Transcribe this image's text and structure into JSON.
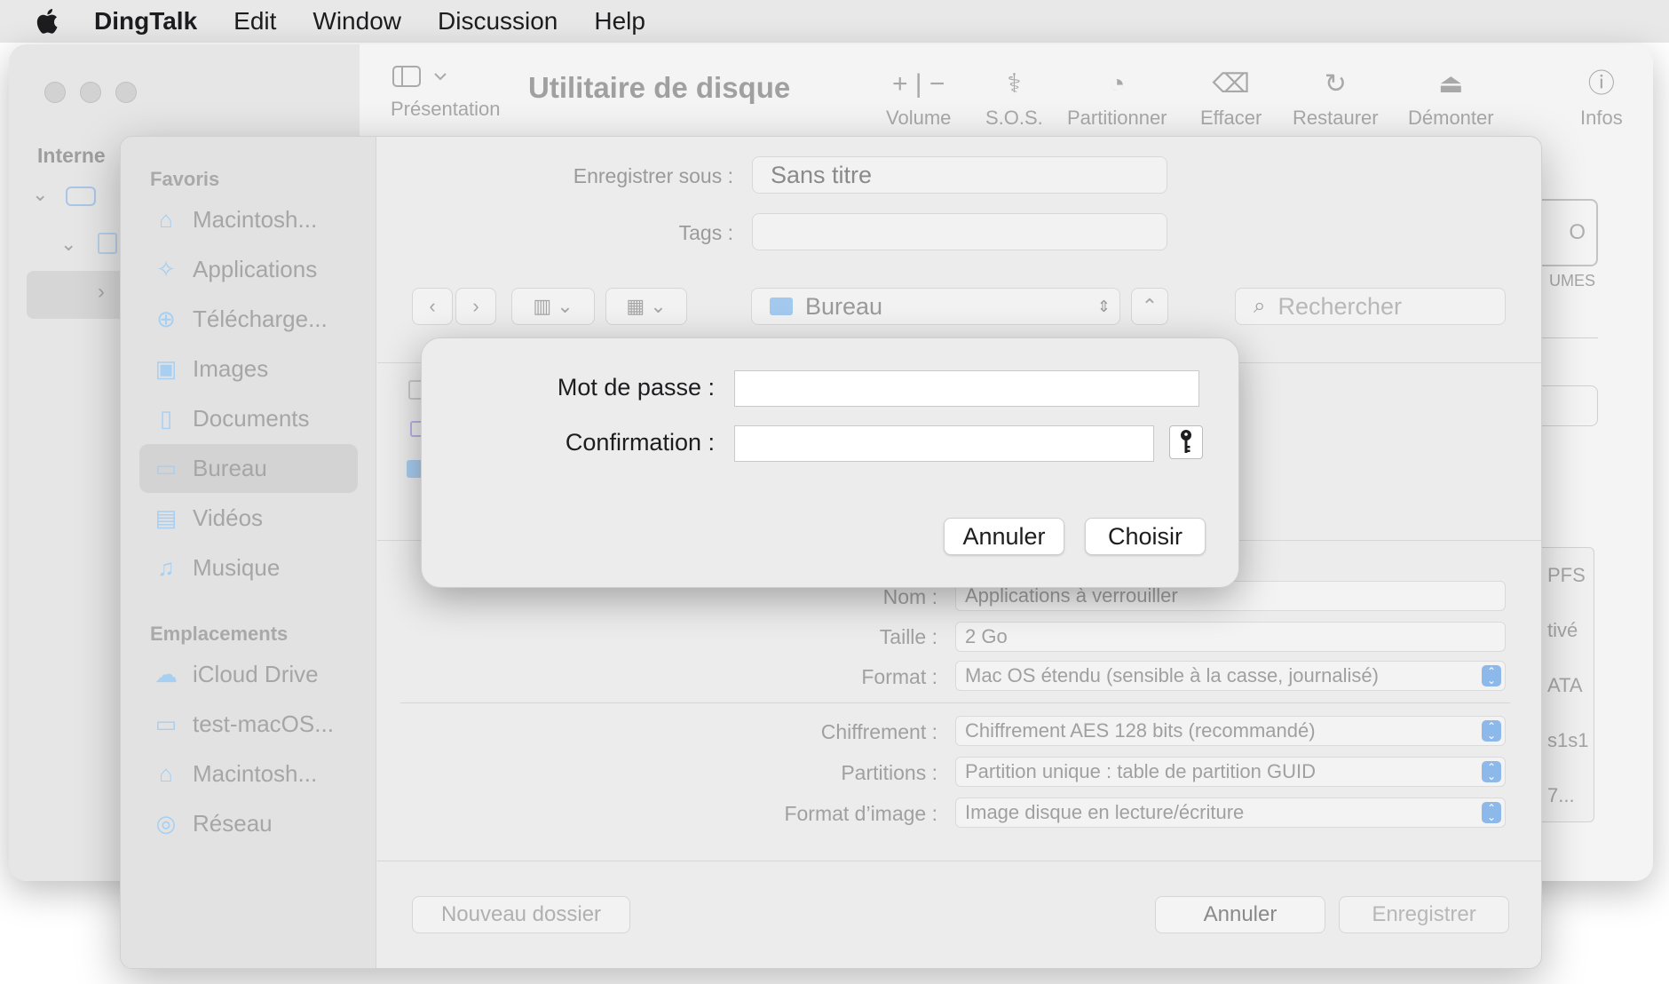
{
  "menubar": {
    "app": "DingTalk",
    "items": [
      "Edit",
      "Window",
      "Discussion",
      "Help"
    ]
  },
  "disk_utility": {
    "title": "Utilitaire de disque",
    "presentation_label": "Présentation",
    "toolbar": [
      {
        "label": "Volume",
        "icon": "plus-minus-icon"
      },
      {
        "label": "S.O.S.",
        "icon": "stethoscope-icon"
      },
      {
        "label": "Partitionner",
        "icon": "pie-icon"
      },
      {
        "label": "Effacer",
        "icon": "erase-icon"
      },
      {
        "label": "Restaurer",
        "icon": "restore-icon"
      },
      {
        "label": "Démonter",
        "icon": "eject-icon"
      },
      {
        "label": "Infos",
        "icon": "info-icon"
      }
    ],
    "sidebar_section": "Interne",
    "right_partials": [
      "PFS",
      "tivé",
      "ATA",
      "s1s1",
      "7...",
      "UMES"
    ]
  },
  "save_sheet": {
    "save_as_label": "Enregistrer sous :",
    "save_as_value": "Sans titre",
    "tags_label": "Tags :",
    "location": "Bureau",
    "search_placeholder": "Rechercher",
    "favorites_header": "Favoris",
    "favorites": [
      {
        "label": "Macintosh...",
        "icon": "drive-icon"
      },
      {
        "label": "Applications",
        "icon": "applications-icon"
      },
      {
        "label": "Télécharge...",
        "icon": "downloads-icon"
      },
      {
        "label": "Images",
        "icon": "images-icon"
      },
      {
        "label": "Documents",
        "icon": "document-icon"
      },
      {
        "label": "Bureau",
        "icon": "desktop-icon"
      },
      {
        "label": "Vidéos",
        "icon": "videos-icon"
      },
      {
        "label": "Musique",
        "icon": "music-icon"
      }
    ],
    "locations_header": "Emplacements",
    "locations": [
      {
        "label": "iCloud Drive",
        "icon": "cloud-icon"
      },
      {
        "label": "test-macOS...",
        "icon": "computer-icon"
      },
      {
        "label": "Macintosh...",
        "icon": "drive-icon"
      },
      {
        "label": "Réseau",
        "icon": "network-icon"
      }
    ],
    "form": {
      "name_label": "Nom :",
      "name_value": "Applications à verrouiller",
      "size_label": "Taille :",
      "size_value": "2 Go",
      "format_label": "Format :",
      "format_value": "Mac OS étendu (sensible à la casse, journalisé)",
      "encryption_label": "Chiffrement :",
      "encryption_value": "Chiffrement AES 128 bits (recommandé)",
      "partitions_label": "Partitions :",
      "partitions_value": "Partition unique : table de partition GUID",
      "image_format_label": "Format d’image :",
      "image_format_value": "Image disque en lecture/écriture"
    },
    "new_folder": "Nouveau dossier",
    "cancel": "Annuler",
    "save": "Enregistrer"
  },
  "password_dialog": {
    "password_label": "Mot de passe :",
    "confirm_label": "Confirmation :",
    "password_value": "",
    "confirm_value": "",
    "cancel": "Annuler",
    "choose": "Choisir"
  }
}
